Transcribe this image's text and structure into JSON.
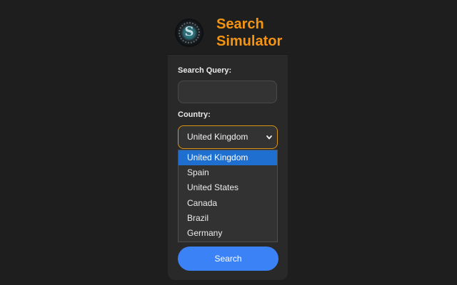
{
  "header": {
    "title": "Search\nSimulator",
    "logo_letter": "S",
    "brand_color": "#f39412"
  },
  "form": {
    "query_label": "Search Query:",
    "query_value": "",
    "country_label": "Country:",
    "country_selected": "United Kingdom",
    "country_options": [
      "United Kingdom",
      "Spain",
      "United States",
      "Canada",
      "Brazil",
      "Germany"
    ],
    "search_button_label": "Search",
    "accent_color": "#3b82f6",
    "selected_option_color": "#1f6fd1",
    "focus_border_color": "#d99417"
  }
}
